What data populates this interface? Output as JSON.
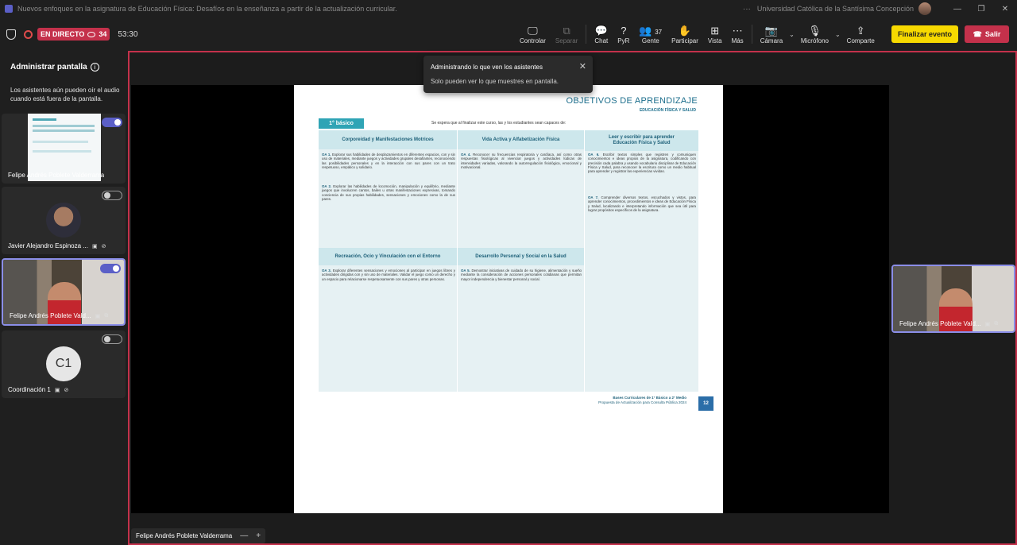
{
  "titlebar": {
    "title": "Nuevos enfoques en la asignatura de Educación Física: Desafíos en la enseñanza a partir de la actualización curricular.",
    "more": "···",
    "org": "Universidad Católica de la Santísima Concepción",
    "minimize": "—",
    "maximize": "❐",
    "close": "✕"
  },
  "meeting": {
    "live_label": "EN DIRECTO",
    "viewers": "34",
    "timer": "53:30"
  },
  "toolbar": {
    "control": "Controlar",
    "stop": "Separar",
    "chat": "Chat",
    "qa": "PyR",
    "people": "Gente",
    "people_count": "37",
    "raise": "Participar",
    "view": "Vista",
    "more": "Más",
    "camera": "Cámara",
    "mic": "Micrófono",
    "share": "Comparte",
    "end": "Finalizar evento",
    "leave": "Salir"
  },
  "sidebar": {
    "title": "Administrar pantalla",
    "info": "i",
    "description": "Los asistentes aún pueden oír el audio cuando está fuera de la pantalla.",
    "tiles": [
      {
        "name": "Felipe Andrés Poblete Valderrama",
        "on": true
      },
      {
        "name": "Javier Alejandro Espinoza ...",
        "on": false
      },
      {
        "name": "Felipe Andrés Poblete Vald...",
        "on": true
      },
      {
        "name": "Coordinación 1",
        "initials": "C1",
        "on": false
      }
    ]
  },
  "toast": {
    "title": "Administrando lo que ven los asistentes",
    "body": "Solo pueden ver lo que muestres en pantalla.",
    "close": "✕"
  },
  "doc": {
    "title": "OBJETIVOS DE APRENDIZAJE",
    "subtitle": "EDUCACIÓN FÍSICA Y SALUD",
    "grade": "1° básico",
    "intro": "Se espera que al finalizar este curso, las y los estudiantes sean capaces de:",
    "headers": [
      "Corporeidad y Manifestaciones Motrices",
      "Vida Activa y Alfabetización Física",
      "Leer y escribir para aprender Educación Física y Salud",
      "Recreación, Ocio y Vinculación con el Entorno",
      "Desarrollo Personal y Social en la Salud"
    ],
    "oa": [
      {
        "code": "OA 1.",
        "text": "Explorar sus habilidades de desplazamientos en diferentes espacios, con y sin uso de materiales, mediante juegos y actividades grupales desafiantes, reconociendo las posibilidades personales y en la interacción con sus pares con un trato respetuoso, empático y solidario."
      },
      {
        "code": "OA 2.",
        "text": "Explorar las habilidades de locomoción, manipulación y equilibrio, mediante juegos que involucren cantos, bailes u otras manifestaciones expresivas, tomando conciencia de sus propias habilidades, sensaciones y emociones como la de sus pares."
      },
      {
        "code": "OA 3.",
        "text": "Explorar diferentes sensaciones y emociones al participar en juegos libres y actividades dirigidas con y sin uso de materiales. Validar el juego como un derecho y un espacio para relacionarse respetuosamente con sus pares y otras personas."
      },
      {
        "code": "OA 4.",
        "text": "Reconocer su frecuencias respiratoria y cardíaca, así como otras respuestas fisiológicas al vivenciar juegos y actividades lúdicas de intensidades variadas, valorando la autorregulación fisiológica, emocional y motivacional."
      },
      {
        "code": "OA 5.",
        "text": "Demostrar iniciativas de cuidado de su higiene, alimentación y sueño mediante la consideración de acciones personales cotidianas que permitan mayor independencia y bienestar personal y social."
      },
      {
        "code": "OA 6.",
        "text": "Escribir textos simples que registren y comuniquen conocimientos e ideas propios de la asignatura, codificando con precisión cada palabra y usando vocabulario disciplinar de Educación Física y Salud, para reconocer la escritura como un medio habitual para aprender y registrar las experiencias vividas."
      },
      {
        "code": "OA 7.",
        "text": "Comprender diversos textos, escuchados y vistos, para aprender conocimientos, procedimientos e ideas de Educación Física y Salud, localizando e interpretando información que sea útil para lograr propósitos específicos de la asignatura."
      }
    ],
    "footer_line1": "Bases Curriculares de 1° Básico a 2° Medio",
    "footer_line2": "Propuesta de Actualización para Consulta Pública 2024",
    "page": "12"
  },
  "right_tile": {
    "name": "Felipe Andrés Poblete Vald..."
  },
  "presenter": {
    "name": "Felipe Andrés Poblete Valderrama",
    "minus": "—",
    "plus": "+"
  },
  "colors": {
    "accent": "#5b5fc7",
    "live": "#c4314b",
    "end": "#f7d900",
    "doc_teal": "#2fa4b5"
  }
}
